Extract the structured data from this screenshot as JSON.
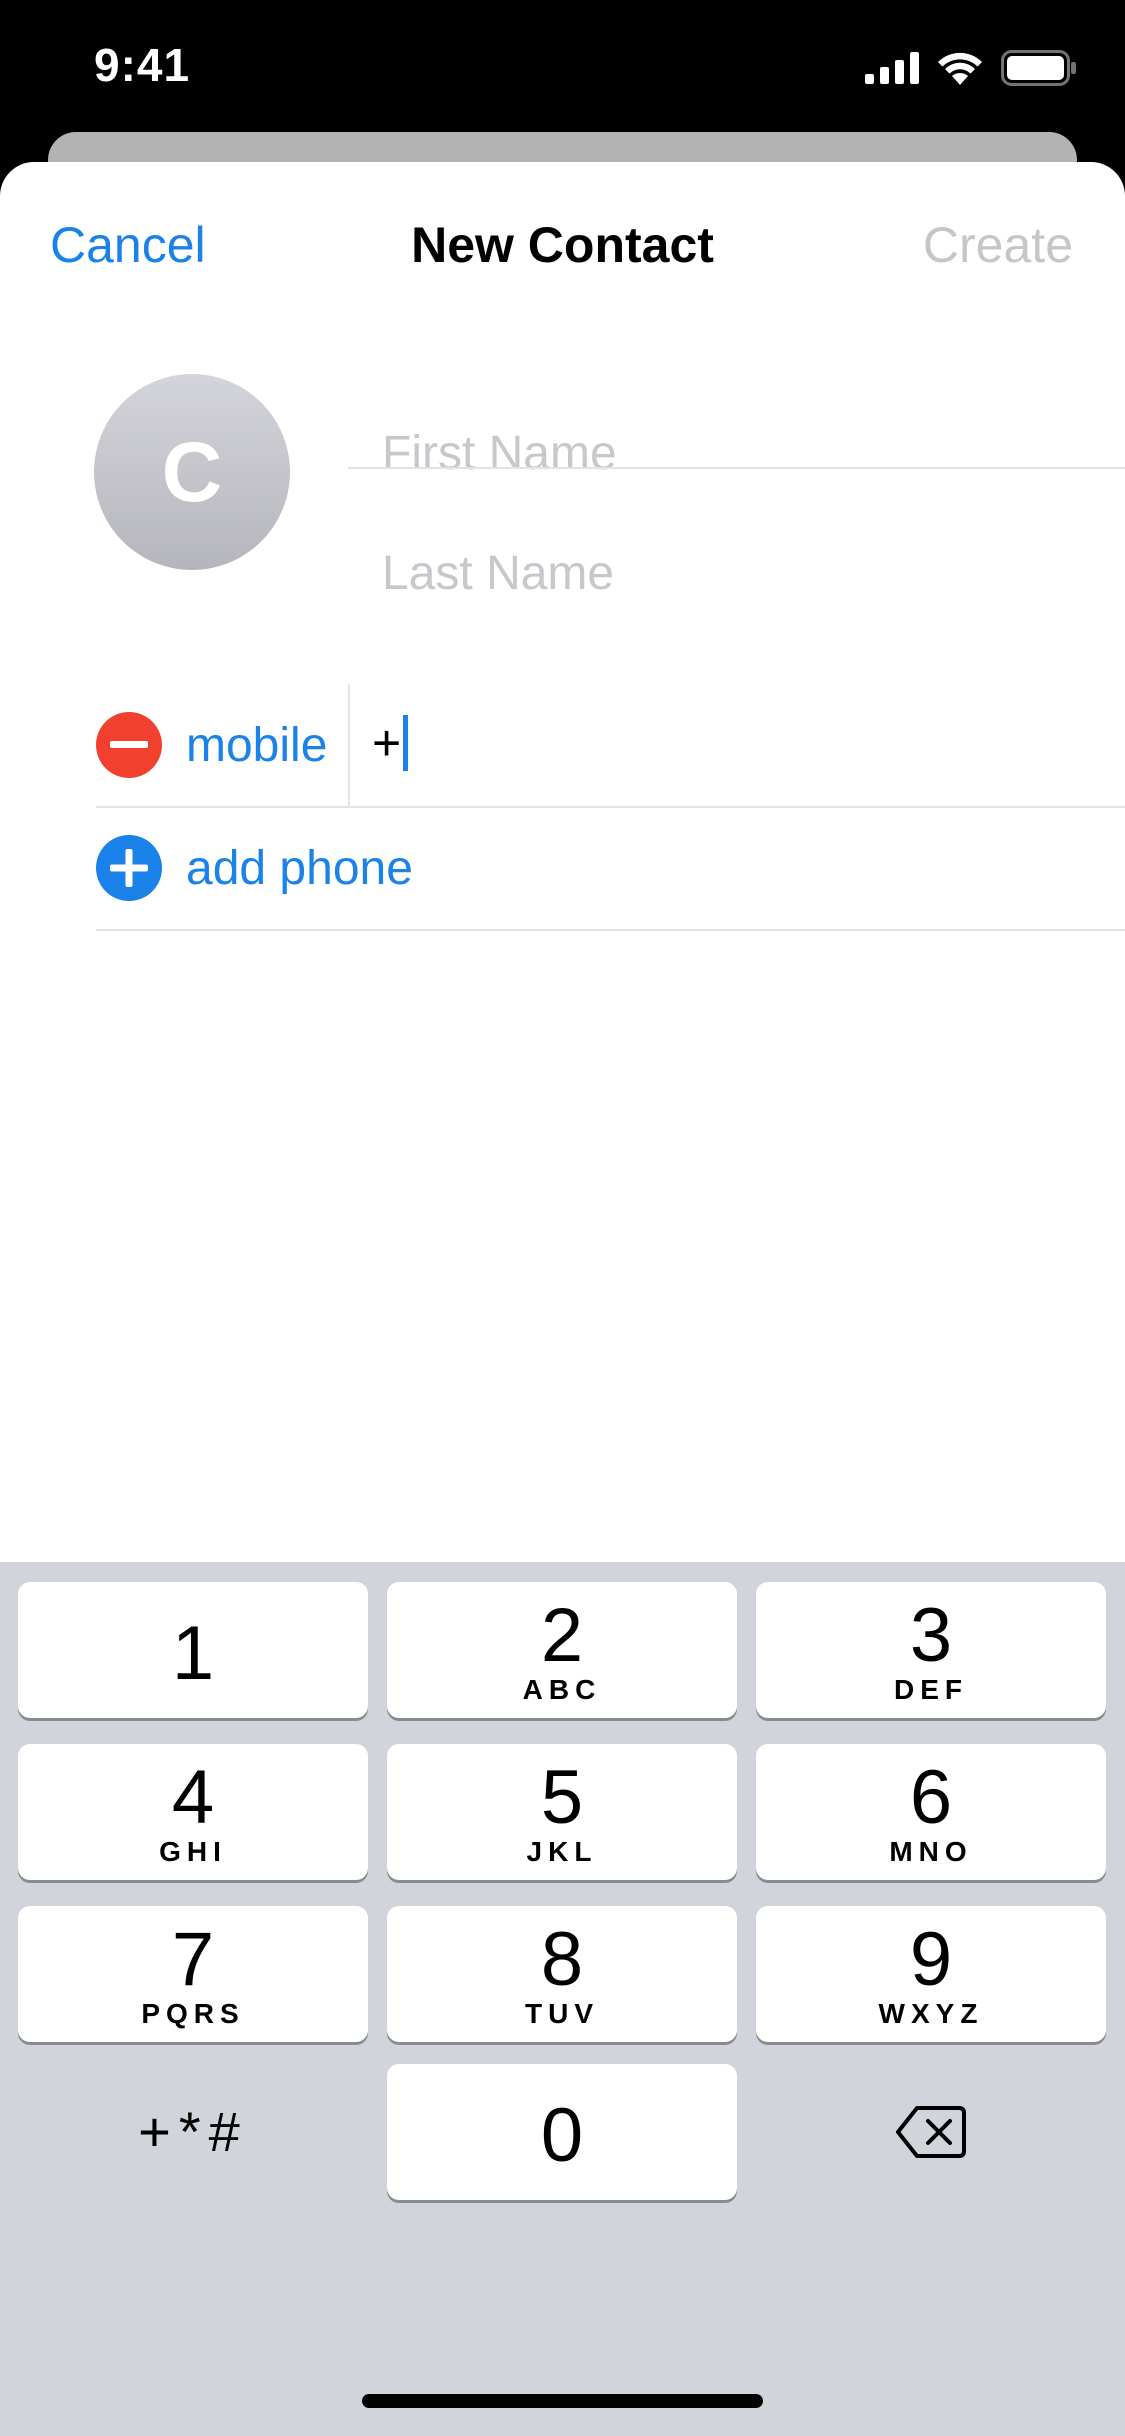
{
  "status_bar": {
    "time": "9:41"
  },
  "nav": {
    "cancel": "Cancel",
    "title": "New Contact",
    "create": "Create"
  },
  "avatar": {
    "initial": "C"
  },
  "fields": {
    "first_name_placeholder": "First Name",
    "last_name_placeholder": "Last Name"
  },
  "phone": {
    "label": "mobile",
    "value": "+",
    "add_label": "add phone"
  },
  "keyboard": {
    "keys": [
      {
        "digit": "1",
        "letters": ""
      },
      {
        "digit": "2",
        "letters": "ABC"
      },
      {
        "digit": "3",
        "letters": "DEF"
      },
      {
        "digit": "4",
        "letters": "GHI"
      },
      {
        "digit": "5",
        "letters": "JKL"
      },
      {
        "digit": "6",
        "letters": "MNO"
      },
      {
        "digit": "7",
        "letters": "PQRS"
      },
      {
        "digit": "8",
        "letters": "TUV"
      },
      {
        "digit": "9",
        "letters": "WXYZ"
      },
      {
        "digit": "0",
        "letters": ""
      }
    ],
    "symbols": "+*#"
  },
  "colors": {
    "accent": "#1a82e8",
    "destructive": "#f2402f",
    "disabled": "#c6c6c8",
    "keyboard_bg": "#d1d4db"
  }
}
